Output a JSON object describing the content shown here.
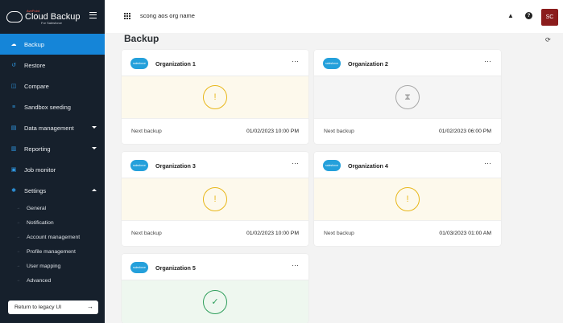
{
  "app": {
    "brand_top": "AvePoint",
    "title": "Cloud Backup",
    "subtitle": "For Salesforce"
  },
  "sidebar": {
    "items": [
      {
        "label": "Backup",
        "icon": "cloud-upload-icon",
        "active": true
      },
      {
        "label": "Restore",
        "icon": "restore-icon"
      },
      {
        "label": "Compare",
        "icon": "compare-icon"
      },
      {
        "label": "Sandbox seeding",
        "icon": "database-icon"
      },
      {
        "label": "Data management",
        "icon": "data-icon",
        "expandable": true
      },
      {
        "label": "Reporting",
        "icon": "chart-icon",
        "expandable": true
      },
      {
        "label": "Job monitor",
        "icon": "monitor-icon"
      },
      {
        "label": "Settings",
        "icon": "gear-icon",
        "expanded": true
      }
    ],
    "settings_subitems": [
      "General",
      "Notification",
      "Account management",
      "Profile management",
      "User mapping",
      "Advanced"
    ],
    "legacy_button": "Return to legacy UI"
  },
  "topbar": {
    "org_name": "scong aos org name",
    "avatar_initials": "SC"
  },
  "main": {
    "title": "Backup",
    "next_backup_label": "Next backup",
    "cards": [
      {
        "name": "Organization 1",
        "logo_text": "salesforce",
        "status": "warning",
        "status_glyph": "!",
        "next_backup": "01/02/2023 10:00 PM"
      },
      {
        "name": "Organization 2",
        "logo_text": "salesforce",
        "status": "pending",
        "status_glyph": "⧗",
        "next_backup": "01/02/2023 06:00 PM"
      },
      {
        "name": "Organization 3",
        "logo_text": "salesforce",
        "status": "warning",
        "status_glyph": "!",
        "next_backup": "01/02/2023 10:00 PM"
      },
      {
        "name": "Organization 4",
        "logo_text": "salesforce",
        "status": "warning",
        "status_glyph": "!",
        "next_backup": "01/03/2023 01:00 AM"
      },
      {
        "name": "Organization 5",
        "logo_text": "salesforce",
        "status": "success",
        "status_glyph": "✓",
        "next_backup": ""
      }
    ]
  },
  "colors": {
    "sidebar_bg": "#16202c",
    "accent": "#1585d8",
    "warning": "#e8b71a",
    "pending": "#9e9e9e",
    "success": "#2e9e5b",
    "avatar_bg": "#8b1c1c"
  }
}
